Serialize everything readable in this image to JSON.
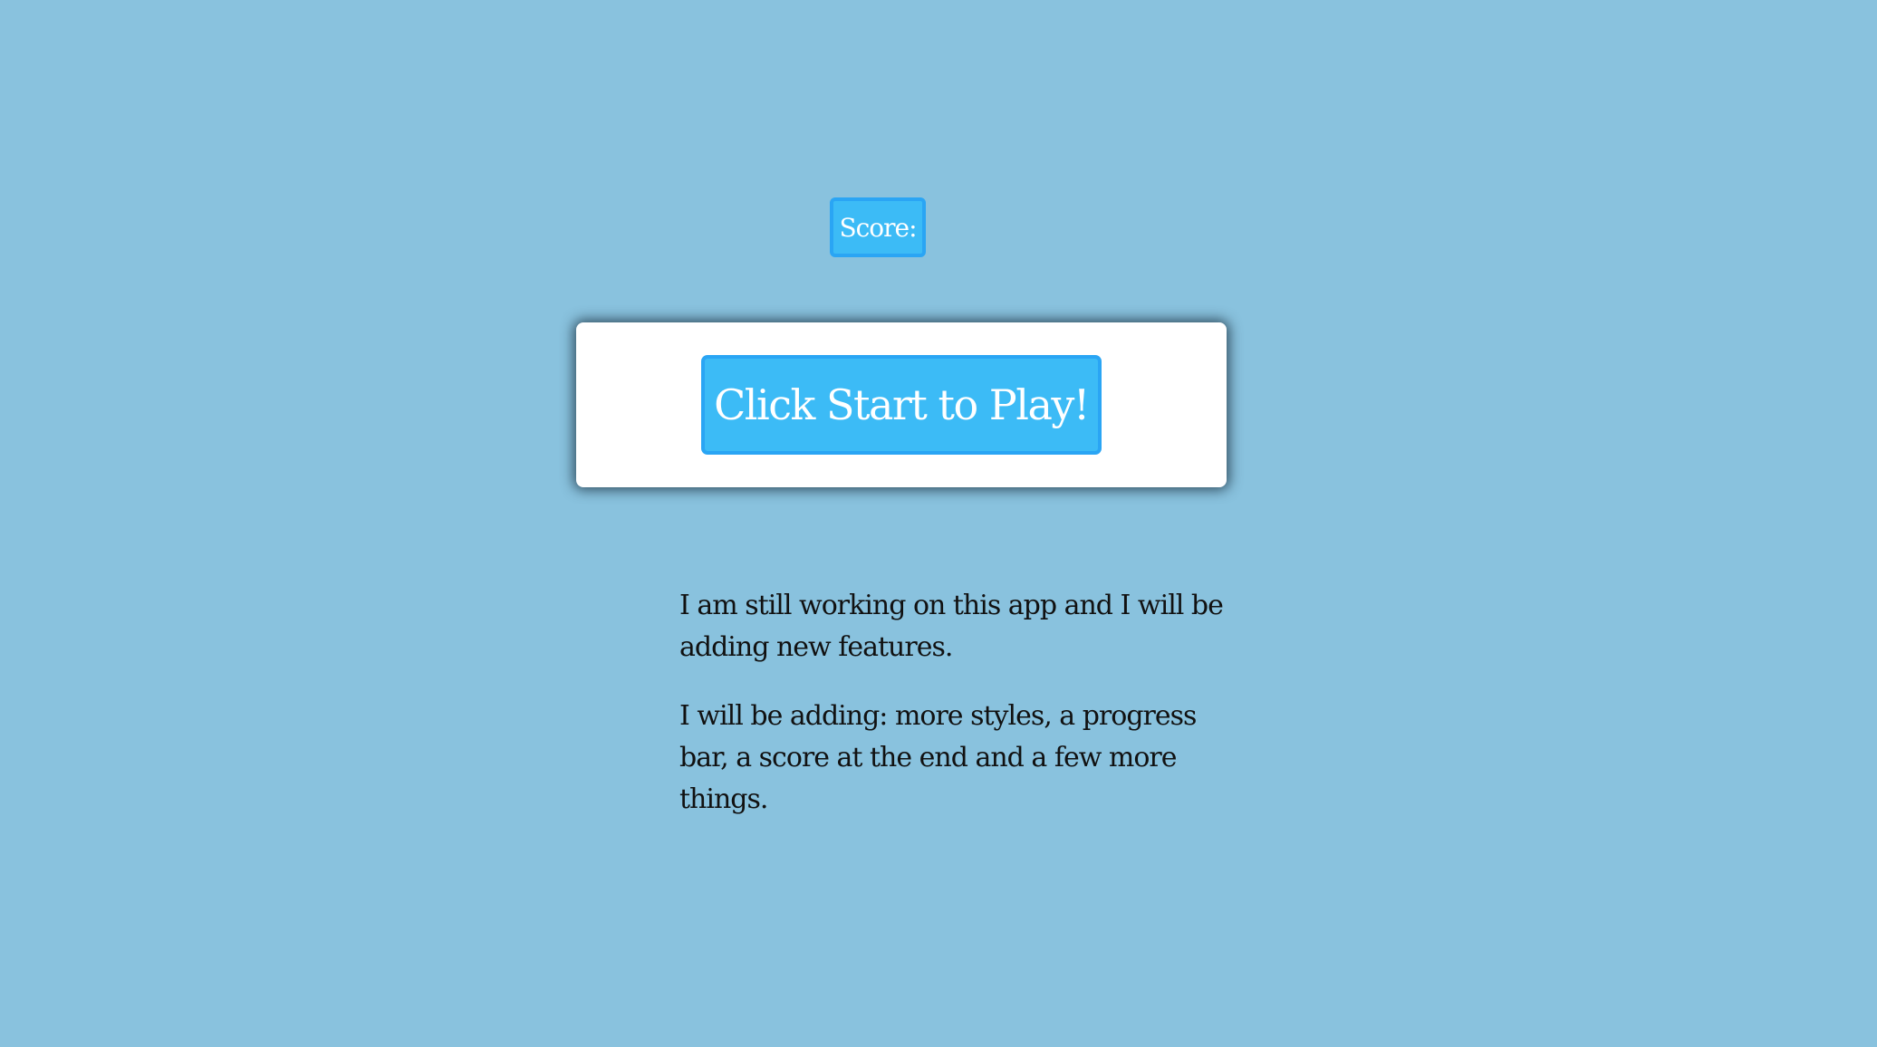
{
  "score": {
    "label": "Score:"
  },
  "start": {
    "button_label": "Click Start to Play!"
  },
  "info": {
    "line1": "I am still working on this app and I will be adding new features.",
    "line2": "I will be adding: more styles, a progress bar, a score at the end and a few more things."
  },
  "colors": {
    "background": "#89c2de",
    "button_fill": "#3cbbf6",
    "button_border": "#2aa5f4",
    "card": "#ffffff"
  }
}
